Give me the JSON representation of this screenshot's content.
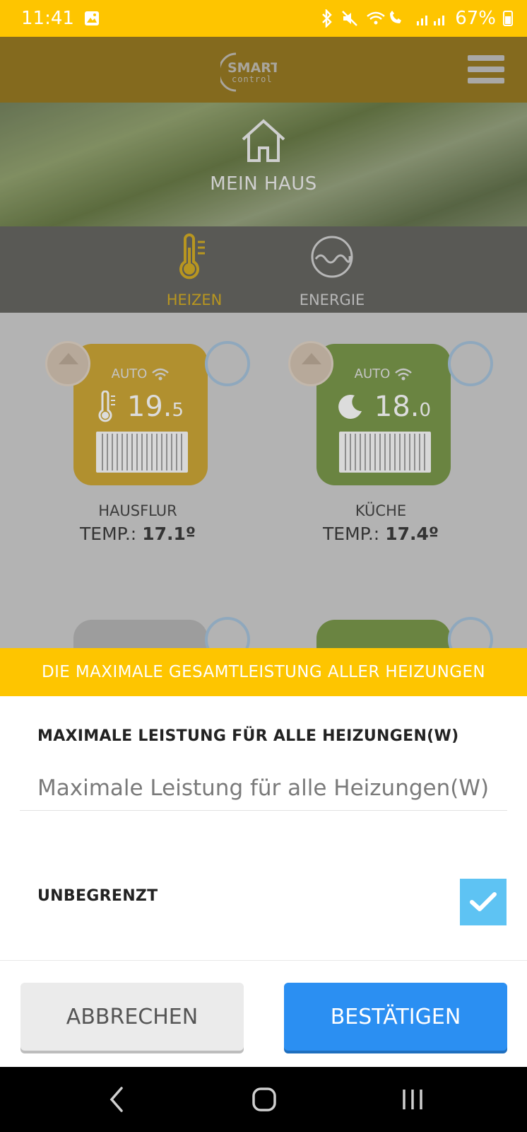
{
  "status_bar": {
    "time": "11:41",
    "battery": "67%"
  },
  "header": {
    "logo_text_top": "SMART",
    "logo_text_bottom": "control"
  },
  "hero": {
    "title": "MEIN HAUS"
  },
  "tabs": [
    {
      "label": "HEIZEN",
      "active": true
    },
    {
      "label": "ENERGIE",
      "active": false
    }
  ],
  "devices": [
    {
      "mode": "AUTO",
      "temp_main": "19.",
      "temp_dec": "5",
      "room": "HAUSFLUR",
      "temp_label": "TEMP.:",
      "temp_value": "17.1º",
      "color": "#b1902f"
    },
    {
      "mode": "AUTO",
      "temp_main": "18.",
      "temp_dec": "0",
      "room": "KÜCHE",
      "temp_label": "TEMP.:",
      "temp_value": "17.4º",
      "color": "#6a8441"
    }
  ],
  "modal": {
    "title": "DIE MAXIMALE GESAMTLEISTUNG ALLER HEIZUNGEN",
    "field_label": "MAXIMALE LEISTUNG FÜR ALLE HEIZUNGEN(W)",
    "field_placeholder": "Maximale Leistung für alle Heizungen(W)",
    "field_value": "",
    "unlimited_label": "UNBEGRENZT",
    "unlimited_checked": true,
    "cancel_label": "ABBRECHEN",
    "confirm_label": "BESTÄTIGEN"
  },
  "colors": {
    "accent_yellow": "#fec500",
    "confirm_blue": "#2b8ff2",
    "checkbox_blue": "#5ec3f3"
  }
}
